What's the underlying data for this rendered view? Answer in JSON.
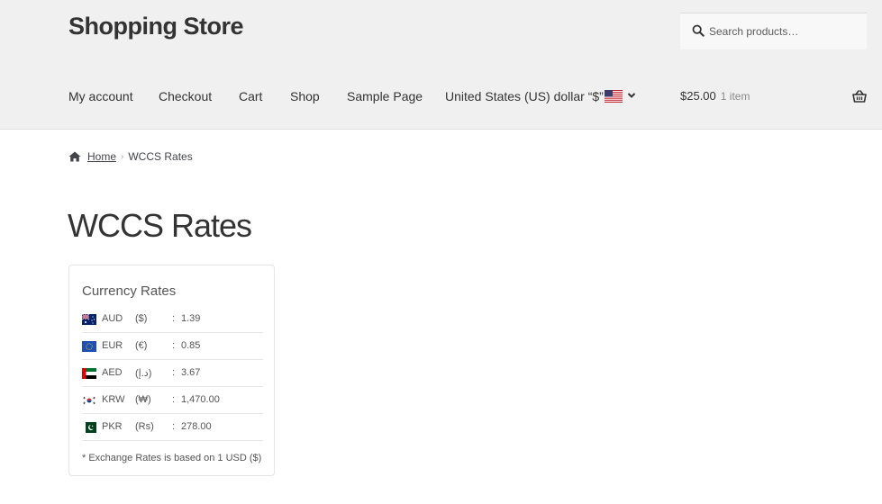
{
  "header": {
    "site_title": "Shopping Store",
    "search_placeholder": "Search products…"
  },
  "nav": {
    "items": [
      "My account",
      "Checkout",
      "Cart",
      "Shop",
      "Sample Page"
    ],
    "currency_label": "United States (US) dollar “$”"
  },
  "cart": {
    "amount": "$25.00",
    "count": "1 item"
  },
  "breadcrumb": {
    "home": "Home",
    "current": "WCCS Rates"
  },
  "page": {
    "title": "WCCS Rates"
  },
  "widget": {
    "title": "Currency Rates",
    "rates": [
      {
        "code": "AUD",
        "symbol": "($)",
        "colon": ":",
        "value": "1.39",
        "flag": "flag-australia-icon"
      },
      {
        "code": "EUR",
        "symbol": "(€)",
        "colon": ":",
        "value": "0.85",
        "flag": "flag-eu-icon"
      },
      {
        "code": "AED",
        "symbol": "(د.إ)",
        "colon": ":",
        "value": "3.67",
        "flag": "flag-uae-icon"
      },
      {
        "code": "KRW",
        "symbol": "(₩)",
        "colon": ":",
        "value": "1,470.00",
        "flag": "flag-korea-icon"
      },
      {
        "code": "PKR",
        "symbol": "(Rs)",
        "colon": ":",
        "value": "278.00",
        "flag": "flag-pakistan-icon"
      }
    ],
    "note": "* Exchange Rates is based on 1 USD ($)"
  }
}
